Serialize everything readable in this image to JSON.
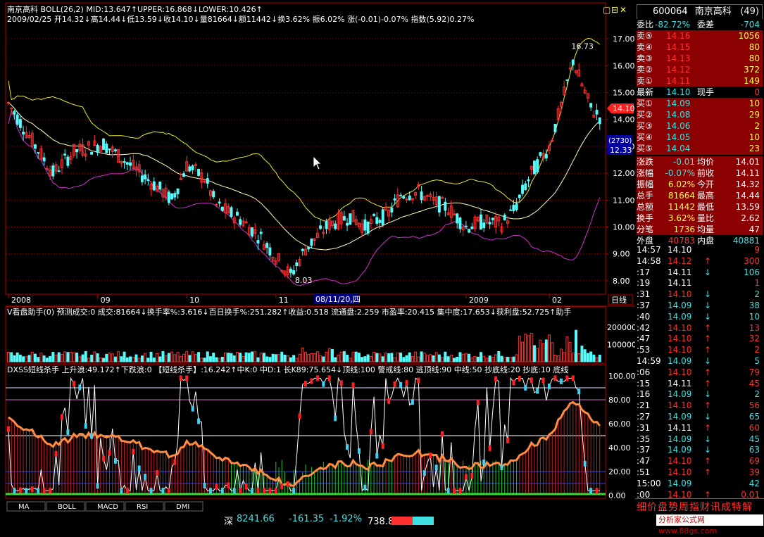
{
  "app": {
    "stock_name": "南京高科",
    "stock_code": "600064",
    "stock_suffix": "(49)"
  },
  "header": {
    "line1": "南京高科  BOLL(26,2)  MID:13.647↑UPPER:16.868↓LOWER:10.426↑",
    "line2": "2009/02/25 开14.32↓高14.44↓低13.59↓收14.10↓量81664↓额11442↓换3.62%  振6.02%  涨(-0.01)-0.07%  指数(5.92)0.27%"
  },
  "window_controls": {
    "a": "▢",
    "b": "⊟",
    "c": "✕"
  },
  "chart_data": [
    {
      "type": "candlestick",
      "indicator": "BOLL(26,2)",
      "ylim": [
        7.5,
        17.5
      ],
      "y_ticks": [
        "17.00",
        "16.00",
        "15.00",
        "14.00",
        "13.00",
        "12.00",
        "11.00",
        "10.00",
        "9.00",
        "8.00"
      ],
      "y_tick_values": [
        17,
        16,
        15,
        14,
        13,
        12,
        11,
        10,
        9,
        8
      ],
      "x_labels": [
        "2008",
        "09",
        "10",
        "11",
        "2009",
        "02"
      ],
      "x_label_index": [
        0,
        30,
        60,
        90,
        154,
        182
      ],
      "x_marker": "08/11/20,四",
      "x_marker_index": 110,
      "price_tag": "14.10",
      "side_box_label": "(2730)",
      "side_box_value": "12.33",
      "annotations": [
        {
          "text": "16.73",
          "index": 188,
          "value": 16.73
        },
        {
          "text": "8.03",
          "index": 95,
          "value": 8.03
        }
      ],
      "bands": {
        "mid": 13.647,
        "upper": 16.868,
        "lower": 10.426
      },
      "last": {
        "open": 14.32,
        "high": 14.44,
        "low": 13.59,
        "close": 14.1
      }
    },
    {
      "type": "bar",
      "title": "V看盘助手(0) 预测成交:0  成交:81664↓换手率%:3.616↓百日换手%:251.282↑收益:0.518 流通盘:2.259 市盈率:20.415 集中度:17.653↓获利盘:52.725↑助手",
      "y_ticks": [
        "200000",
        "100000"
      ],
      "y_tick_values": [
        200000,
        100000
      ],
      "ylim": [
        0,
        260000
      ],
      "last_volume": 81664
    },
    {
      "type": "line",
      "title": "DXSS短线杀手 上升浪:49.172↑下跌浪:0 【短线杀手】:16.242↑中K:0 中D:1 长K89:75.654↓顶线:100 警戒线:80 逃顶线:90 中线:50 抄底线:20 抄底:10 底线",
      "ylim": [
        0,
        100
      ],
      "y_ticks": [
        "100.00",
        "80.00",
        "60.00",
        "40.00",
        "20.00",
        "0.00"
      ],
      "y_tick_values": [
        100,
        80,
        60,
        40,
        20,
        0
      ],
      "reference_lines": [
        90,
        80,
        50,
        20,
        10
      ]
    }
  ],
  "tabs": [
    "MA",
    "BOLL",
    "MACD",
    "RSI",
    "DMI"
  ],
  "x_axis_tab": "日线",
  "quote": {
    "weibi_label": "委比",
    "weibi_value": "-82.72%",
    "weicha_label": "委差",
    "weicha_value": "-704",
    "asks": [
      {
        "label": "卖⑤",
        "price": "14.16",
        "vol": "1056"
      },
      {
        "label": "卖④",
        "price": "14.15",
        "vol": "80"
      },
      {
        "label": "卖③",
        "price": "14.13",
        "vol": "80"
      },
      {
        "label": "卖②",
        "price": "14.12",
        "vol": "372"
      },
      {
        "label": "卖①",
        "price": "14.11",
        "vol": "149"
      }
    ],
    "last": {
      "label": "最新",
      "price": "14.10",
      "label2": "现手",
      "vol": "0"
    },
    "bids": [
      {
        "label": "买①",
        "price": "14.09",
        "vol": "10"
      },
      {
        "label": "买②",
        "price": "14.08",
        "vol": "29"
      },
      {
        "label": "买③",
        "price": "14.06",
        "vol": "2"
      },
      {
        "label": "买④",
        "price": "14.05",
        "vol": "10"
      },
      {
        "label": "买⑤",
        "price": "14.04",
        "vol": "23"
      }
    ],
    "stats": [
      {
        "l1": "涨跌",
        "v1": "-0.01",
        "l2": "均价",
        "v2": "14.01"
      },
      {
        "l1": "涨幅",
        "v1": "-0.07%",
        "l2": "前收",
        "v2": "14.11"
      },
      {
        "l1": "振幅",
        "v1": "6.02%",
        "l2": "今开",
        "v2": "14.32"
      },
      {
        "l1": "总手",
        "v1": "81664",
        "l2": "最高",
        "v2": "14.44"
      },
      {
        "l1": "总额",
        "v1": "11442",
        "l2": "最低",
        "v2": "13.59"
      },
      {
        "l1": "换手",
        "v1": "3.62%",
        "l2": "量比",
        "v2": "2.62"
      },
      {
        "l1": "分笔",
        "v1": "1736",
        "l2": "均量",
        "v2": "47"
      }
    ],
    "outer": {
      "l1": "外盘",
      "v1": "40783",
      "l2": "内盘",
      "v2": "40881"
    }
  },
  "ticks": [
    {
      "t": "14:57",
      "p": "14.10",
      "a": "",
      "v": "9",
      "vc": "#ff3030",
      "pc": "#ffffff"
    },
    {
      "t": "14:58",
      "p": "14.12",
      "a": "↑",
      "v": "300",
      "vc": "#ff3030",
      "pc": "#ff3030"
    },
    {
      "t": ":17",
      "p": "14.11",
      "a": "↓",
      "v": "106",
      "vc": "#40e0e0",
      "pc": "#ffffff"
    },
    {
      "t": ":19",
      "p": "14.11",
      "a": "",
      "v": "1",
      "vc": "#ff3030",
      "pc": "#ffffff"
    },
    {
      "t": ":31",
      "p": "14.10",
      "a": "↓",
      "v": "2",
      "vc": "#40e0e0",
      "pc": "#ff3030"
    },
    {
      "t": ":37",
      "p": "14.09",
      "a": "↓",
      "v": "38",
      "vc": "#40e0e0",
      "pc": "#40e0e0"
    },
    {
      "t": ":40",
      "p": "14.09",
      "a": "↓",
      "v": "10",
      "vc": "#40e0e0",
      "pc": "#40e0e0"
    },
    {
      "t": ":42",
      "p": "14.10",
      "a": "↑",
      "v": "13",
      "vc": "#ff3030",
      "pc": "#ff3030"
    },
    {
      "t": ":47",
      "p": "14.10",
      "a": "↑",
      "v": "32",
      "vc": "#ff3030",
      "pc": "#ff3030"
    },
    {
      "t": ":53",
      "p": "14.10",
      "a": "↑",
      "v": "2",
      "vc": "#ff3030",
      "pc": "#ff3030"
    },
    {
      "t": "14:59",
      "p": "14.09",
      "a": "↓",
      "v": "5",
      "vc": "#40e0e0",
      "pc": "#40e0e0"
    },
    {
      "t": ":06",
      "p": "14.10",
      "a": "↑",
      "v": "79",
      "vc": "#ff3030",
      "pc": "#ff3030"
    },
    {
      "t": ":15",
      "p": "14.11",
      "a": "↑",
      "v": "45",
      "vc": "#ff3030",
      "pc": "#ffffff"
    },
    {
      "t": ":16",
      "p": "14.09",
      "a": "↓",
      "v": "2",
      "vc": "#40e0e0",
      "pc": "#40e0e0"
    },
    {
      "t": ":21",
      "p": "14.10",
      "a": "↑",
      "v": "56",
      "vc": "#ff3030",
      "pc": "#ff3030"
    },
    {
      "t": ":27",
      "p": "14.09",
      "a": "↓",
      "v": "65",
      "vc": "#40e0e0",
      "pc": "#40e0e0"
    },
    {
      "t": ":31",
      "p": "14.11",
      "a": "↑",
      "v": "60",
      "vc": "#ff3030",
      "pc": "#ffffff"
    },
    {
      "t": ":35",
      "p": "14.09",
      "a": "↓",
      "v": "45",
      "vc": "#40e0e0",
      "pc": "#40e0e0"
    },
    {
      "t": ":37",
      "p": "14.09",
      "a": "↓",
      "v": "63",
      "vc": "#40e0e0",
      "pc": "#40e0e0"
    },
    {
      "t": ":47",
      "p": "14.10",
      "a": "↑",
      "v": "69",
      "vc": "#ff3030",
      "pc": "#ff3030"
    },
    {
      "t": ":51",
      "p": "14.10",
      "a": "↑",
      "v": "39",
      "vc": "#ff3030",
      "pc": "#ff3030"
    },
    {
      "t": "15:00",
      "p": "14.09",
      "a": "",
      "v": "42",
      "vc": "#40e0e0",
      "pc": "#40e0e0"
    },
    {
      "t": ":00",
      "p": "14.10",
      "a": "↑",
      "v": "0.01",
      "vc": "#ff3030",
      "pc": "#ff3030"
    }
  ],
  "bottom_tabs": "细价盘势周指财讯成特解",
  "status": {
    "index_label": "深",
    "index_value": "8241.66",
    "change": "-161.35",
    "pct": "-1.92%",
    "amount": "738.87亿",
    "site": "分析家公式网www.88gs.com"
  },
  "colors": {
    "up": "#ff3030",
    "down": "#54fcfc",
    "mid": "#ffffc0",
    "upper": "#e8e830",
    "lower": "#d030d0",
    "grid": "#8b0000",
    "axis": "#b00000",
    "ma": "#ff8c40"
  }
}
